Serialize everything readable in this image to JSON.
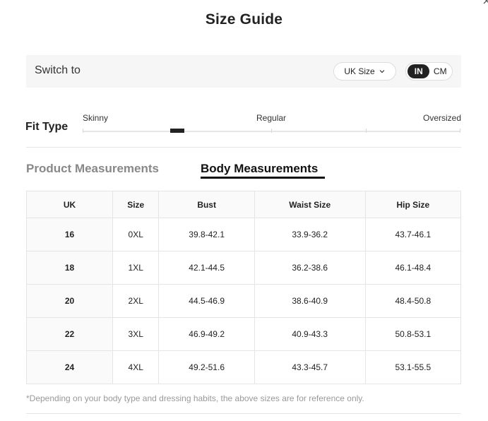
{
  "title": "Size Guide",
  "switch": {
    "label": "Switch to",
    "size_select": "UK Size",
    "units": [
      "IN",
      "CM"
    ],
    "active_unit": "IN"
  },
  "fit_type": {
    "label": "Fit Type",
    "options": [
      "Skinny",
      "Regular",
      "Oversized"
    ],
    "selected_level": 0.25
  },
  "tabs": {
    "product": "Product Measurements",
    "body": "Body Measurements",
    "active": "body"
  },
  "table": {
    "headers": [
      "UK",
      "Size",
      "Bust",
      "Waist Size",
      "Hip Size"
    ],
    "rows": [
      [
        "16",
        "0XL",
        "39.8-42.1",
        "33.9-36.2",
        "43.7-46.1"
      ],
      [
        "18",
        "1XL",
        "42.1-44.5",
        "36.2-38.6",
        "46.1-48.4"
      ],
      [
        "20",
        "2XL",
        "44.5-46.9",
        "38.6-40.9",
        "48.4-50.8"
      ],
      [
        "22",
        "3XL",
        "46.9-49.2",
        "40.9-43.3",
        "50.8-53.1"
      ],
      [
        "24",
        "4XL",
        "49.2-51.6",
        "43.3-45.7",
        "53.1-55.5"
      ]
    ]
  },
  "footnote": "*Depending on your body type and dressing habits, the above sizes are for reference only.",
  "colors": {
    "accent": "#222222",
    "panel": "#f6f6f6",
    "muted_text": "#999999"
  }
}
